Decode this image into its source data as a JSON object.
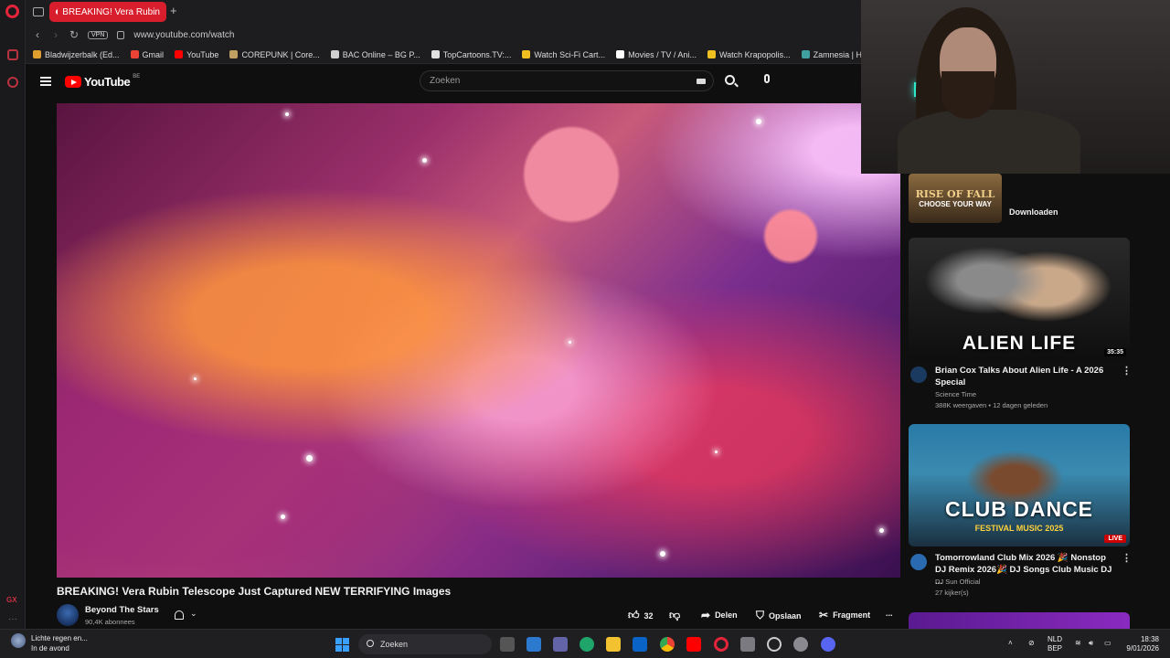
{
  "browser": {
    "tab_title": "BREAKING! Vera Rubin",
    "new_tab_label": "+",
    "vpn_label": "VPN",
    "url": "www.youtube.com/watch",
    "bookmarks": [
      {
        "label": "Bladwijzerbalk (Ed...",
        "color": "#e0a030"
      },
      {
        "label": "Gmail",
        "color": "#ea4335"
      },
      {
        "label": "YouTube",
        "color": "#ff0000"
      },
      {
        "label": "COREPUNK | Core...",
        "color": "#c0a060"
      },
      {
        "label": "BAC Online – BG P...",
        "color": "#d0d0d0"
      },
      {
        "label": "TopCartoons.TV:...",
        "color": "#e0e0e0"
      },
      {
        "label": "Watch Sci-Fi Cart...",
        "color": "#f0c020"
      },
      {
        "label": "Movies / TV / Ani...",
        "color": "#ffffff"
      },
      {
        "label": "Watch Krapopolis...",
        "color": "#f0c020"
      },
      {
        "label": "Zamnesia | Het Be",
        "color": "#40a0a0"
      }
    ]
  },
  "youtube": {
    "logo_text": "YouTube",
    "region": "BE",
    "search_placeholder": "Zoeken"
  },
  "video": {
    "title": "BREAKING! Vera Rubin Telescope Just Captured NEW TERRIFYING Images",
    "channel": "Beyond The Stars",
    "subscribers": "90,4K abonnees",
    "likes": "32",
    "share_label": "Delen",
    "save_label": "Opslaan",
    "clip_label": "Fragment",
    "more_label": "..."
  },
  "sidebar": {
    "ad": {
      "line1": "RISE OF FALL",
      "line2": "CHOOSE YOUR WAY",
      "button": "Downloaden"
    },
    "recommendations": [
      {
        "thumb_text": "ALIEN LIFE",
        "thumb_sub": "",
        "badge": "35:35",
        "title": "Brian Cox Talks About Alien Life - A 2026 Special",
        "channel": "Science Time",
        "meta": "388K weergaven • 12 dagen geleden",
        "avatar_color": "#1a3a60"
      },
      {
        "thumb_text": "CLUB DANCE",
        "thumb_sub": "FESTIVAL MUSIC 2025",
        "badge": "LIVE",
        "title": "Tomorrowland Club Mix 2026 🎉 Nonstop DJ Remix 2026🎉 DJ Songs Club Music DJ ...",
        "channel": "DJ Sun Official",
        "meta": "27 kijker(s)",
        "avatar_color": "#2a6ab0"
      }
    ],
    "menu_label": "⋮"
  },
  "taskbar": {
    "weather_line1": "Lichte regen en...",
    "weather_line2": "In de avond",
    "search_label": "Zoeken",
    "lang_line1": "NLD",
    "lang_line2": "BEP",
    "time": "18:38",
    "date": "9/01/2026"
  }
}
